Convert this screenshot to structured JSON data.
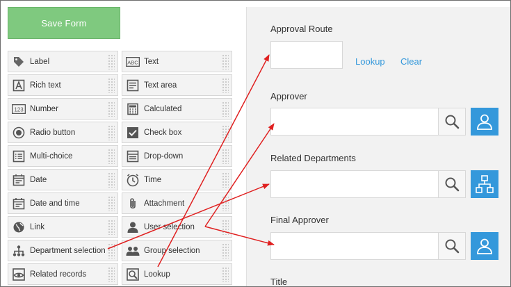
{
  "save_button": "Save Form",
  "palette": {
    "left": [
      {
        "label": "Label",
        "icon": "tag-icon"
      },
      {
        "label": "Rich text",
        "icon": "rich-text-icon"
      },
      {
        "label": "Number",
        "icon": "number-icon"
      },
      {
        "label": "Radio button",
        "icon": "radio-icon"
      },
      {
        "label": "Multi-choice",
        "icon": "multi-choice-icon"
      },
      {
        "label": "Date",
        "icon": "date-icon"
      },
      {
        "label": "Date and time",
        "icon": "date-time-icon"
      },
      {
        "label": "Link",
        "icon": "globe-icon"
      },
      {
        "label": "Department selection",
        "icon": "org-chart-icon"
      },
      {
        "label": "Related records",
        "icon": "eye-icon"
      }
    ],
    "right": [
      {
        "label": "Text",
        "icon": "text-abc-icon"
      },
      {
        "label": "Text area",
        "icon": "text-area-icon"
      },
      {
        "label": "Calculated",
        "icon": "calculator-icon"
      },
      {
        "label": "Check box",
        "icon": "checkbox-icon"
      },
      {
        "label": "Drop-down",
        "icon": "dropdown-icon"
      },
      {
        "label": "Time",
        "icon": "clock-icon"
      },
      {
        "label": "Attachment",
        "icon": "paperclip-icon"
      },
      {
        "label": "User selection",
        "icon": "user-icon"
      },
      {
        "label": "Group selection",
        "icon": "group-icon"
      },
      {
        "label": "Lookup",
        "icon": "lookup-icon"
      }
    ]
  },
  "form": {
    "approval_route": {
      "title": "Approval Route",
      "lookup": "Lookup",
      "clear": "Clear"
    },
    "approver": {
      "title": "Approver"
    },
    "related_departments": {
      "title": "Related Departments"
    },
    "final_approver": {
      "title": "Final Approver"
    },
    "title_field": {
      "title": "Title"
    }
  },
  "colors": {
    "save_green": "#7fc97f",
    "accent_blue": "#3498db",
    "arrow_red": "#e02020"
  }
}
